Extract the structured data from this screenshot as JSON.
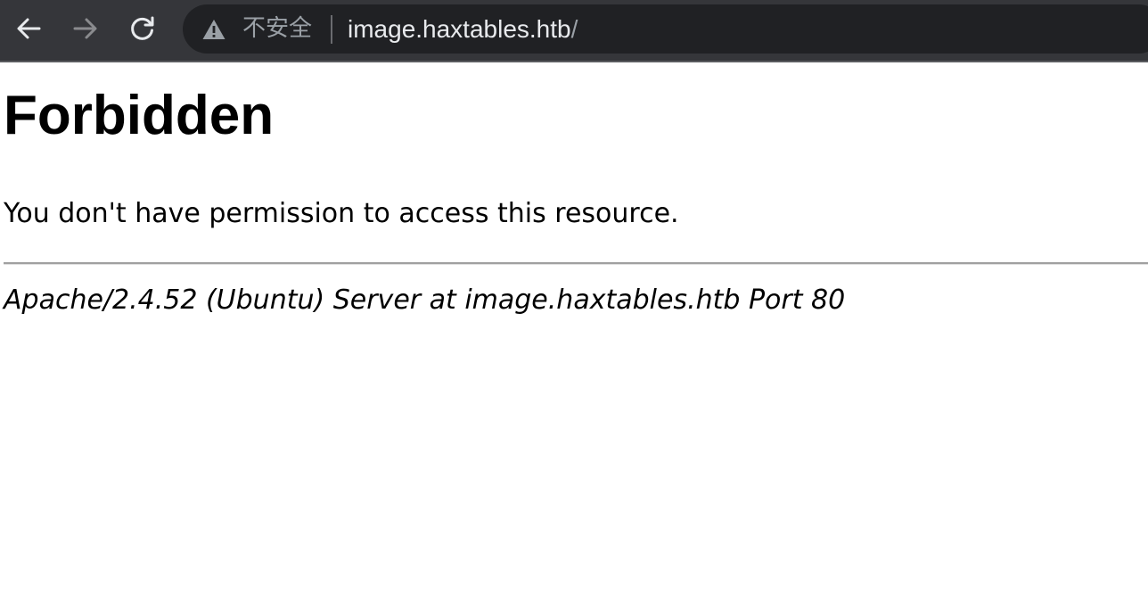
{
  "browser": {
    "back_icon": "arrow-left-icon",
    "forward_icon": "arrow-right-icon",
    "reload_icon": "reload-icon",
    "security_icon": "warning-triangle-icon",
    "security_label": "不安全",
    "url_host": "image.haxtables.htb",
    "url_path": "/",
    "colors": {
      "toolbar": "#35363a",
      "omnibox": "#202124",
      "url_text": "#e8eaed",
      "muted_text": "#9aa0a6",
      "forward_disabled": "#8a8b8e"
    }
  },
  "page": {
    "title": "Forbidden",
    "message": "You don't have permission to access this resource.",
    "server_signature": "Apache/2.4.52 (Ubuntu) Server at image.haxtables.htb Port 80"
  }
}
